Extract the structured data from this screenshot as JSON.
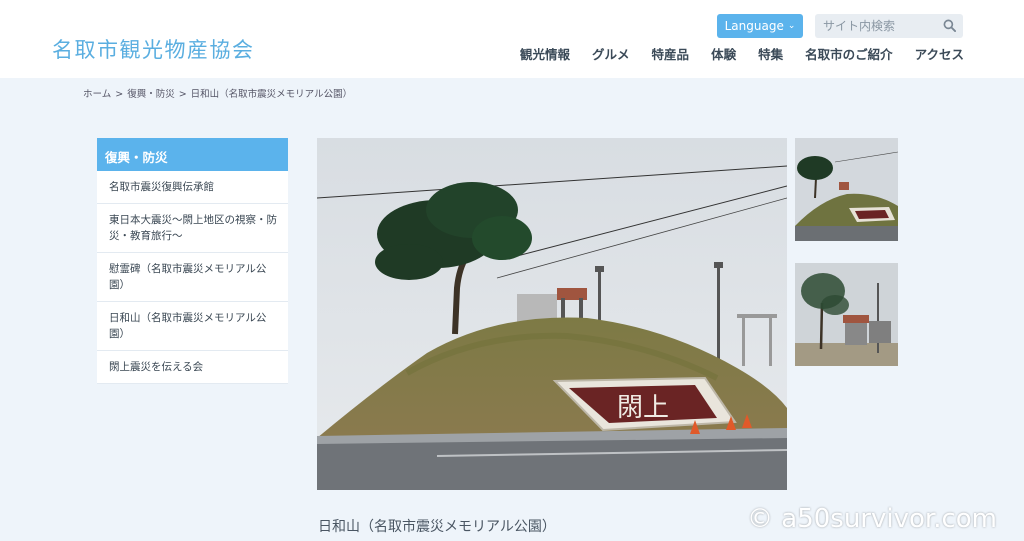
{
  "header": {
    "logo": "名取市観光物産協会",
    "language_label": "Language",
    "search_placeholder": "サイト内検索",
    "nav": [
      "観光情報",
      "グルメ",
      "特産品",
      "体験",
      "特集",
      "名取市のご紹介",
      "アクセス"
    ]
  },
  "breadcrumb": {
    "items": [
      "ホーム",
      "復興・防災",
      "日和山（名取市震災メモリアル公園）"
    ]
  },
  "sidebar": {
    "heading": "復興・防災",
    "items": [
      "名取市震災復興伝承館",
      "東日本大震災～閖上地区の視察・防災・教育旅行～",
      "慰霊碑（名取市震災メモリアル公園）",
      "日和山（名取市震災メモリアル公園）",
      "閖上震災を伝える会"
    ]
  },
  "main": {
    "photo_sign_text": "閖上",
    "caption": "日和山（名取市震災メモリアル公園）"
  },
  "watermark": "© a50survivor.com",
  "colors": {
    "accent": "#5bb3ec",
    "logo": "#5aaee0",
    "background": "#eef4fa"
  }
}
